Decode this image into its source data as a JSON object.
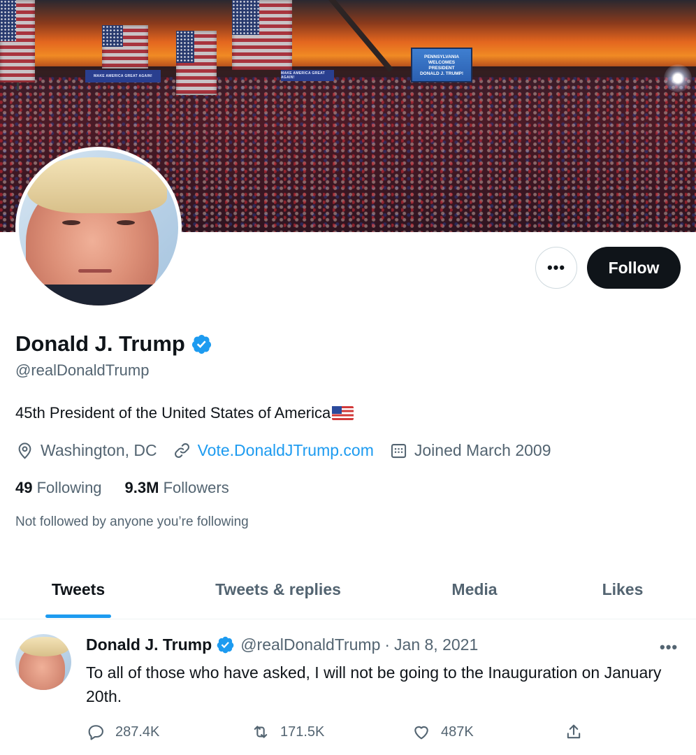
{
  "banner": {
    "sign_left": "MAKE AMERICA GREAT AGAIN!",
    "sign_mid": "MAKE AMERICA GREAT AGAIN!",
    "jumbotron_lines": [
      "PENNSYLVANIA",
      "WELCOMES",
      "PRESIDENT",
      "DONALD J. TRUMP!"
    ]
  },
  "profile": {
    "display_name": "Donald J. Trump",
    "handle": "@realDonaldTrump",
    "bio": "45th President of the United States of America",
    "location": "Washington, DC",
    "website": "Vote.DonaldJTrump.com",
    "joined": "Joined March 2009",
    "following_count": "49",
    "following_label": "Following",
    "followers_count": "9.3M",
    "followers_label": "Followers",
    "not_followed_text": "Not followed by anyone you’re following"
  },
  "actions": {
    "more_label": "•••",
    "follow_label": "Follow"
  },
  "tabs": [
    {
      "label": "Tweets",
      "active": true
    },
    {
      "label": "Tweets & replies",
      "active": false
    },
    {
      "label": "Media",
      "active": false
    },
    {
      "label": "Likes",
      "active": false
    }
  ],
  "tweet": {
    "name": "Donald J. Trump",
    "handle": "@realDonaldTrump",
    "separator": "·",
    "date": "Jan 8, 2021",
    "more": "•••",
    "text": "To all of those who have asked, I will not be going to the Inauguration on January 20th.",
    "replies": "287.4K",
    "retweets": "171.5K",
    "likes": "487K"
  },
  "icons": {
    "verified": "verified-badge-icon",
    "location": "location-pin-icon",
    "link": "link-icon",
    "calendar": "calendar-icon",
    "reply": "reply-icon",
    "retweet": "retweet-icon",
    "like": "heart-icon",
    "share": "share-icon"
  },
  "colors": {
    "accent": "#1d9bf0",
    "text_primary": "#0f1419",
    "text_secondary": "#536471",
    "follow_button_bg": "#0f1419"
  }
}
